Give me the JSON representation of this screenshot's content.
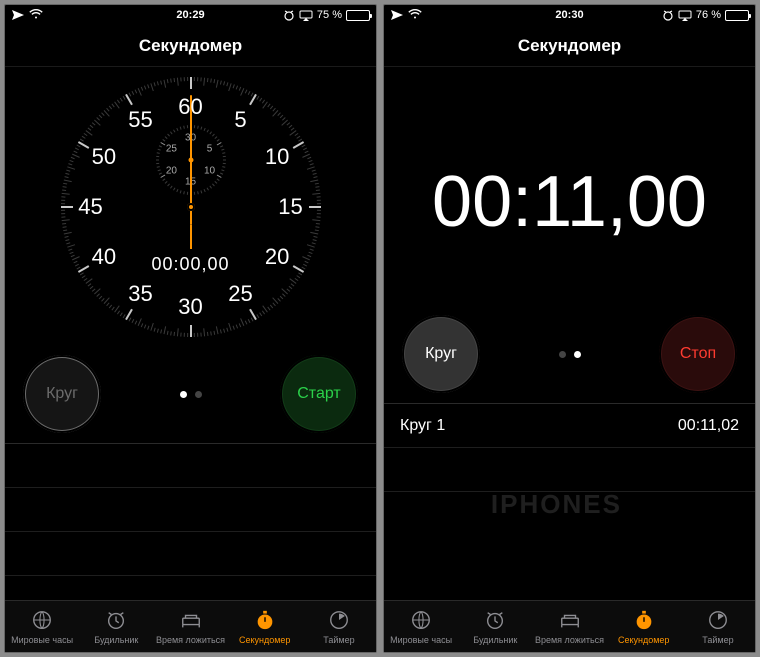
{
  "watermark": "IPHONES",
  "tabs": {
    "world": "Мировые часы",
    "alarm": "Будильник",
    "bedtime": "Время ложиться",
    "stopwatch": "Секундомер",
    "timer": "Таймер"
  },
  "left_screen": {
    "status": {
      "time": "20:29",
      "battery_pct": 75,
      "battery_label": "75 %"
    },
    "title": "Секундомер",
    "analog": {
      "main_numbers": [
        "60",
        "5",
        "10",
        "15",
        "20",
        "25",
        "30",
        "35",
        "40",
        "45",
        "50",
        "55"
      ],
      "sub_numbers": [
        "30",
        "5",
        "10",
        "15",
        "20",
        "25"
      ],
      "digital": "00:00,00"
    },
    "buttons": {
      "lap": "Круг",
      "primary": "Старт"
    },
    "page_index": 0,
    "laps": []
  },
  "right_screen": {
    "status": {
      "time": "20:30",
      "battery_pct": 76,
      "battery_label": "76 %"
    },
    "title": "Секундомер",
    "big_time": "00:11,00",
    "buttons": {
      "lap": "Круг",
      "primary": "Стоп"
    },
    "page_index": 1,
    "laps": [
      {
        "label": "Круг 1",
        "time": "00:11,02"
      }
    ]
  }
}
